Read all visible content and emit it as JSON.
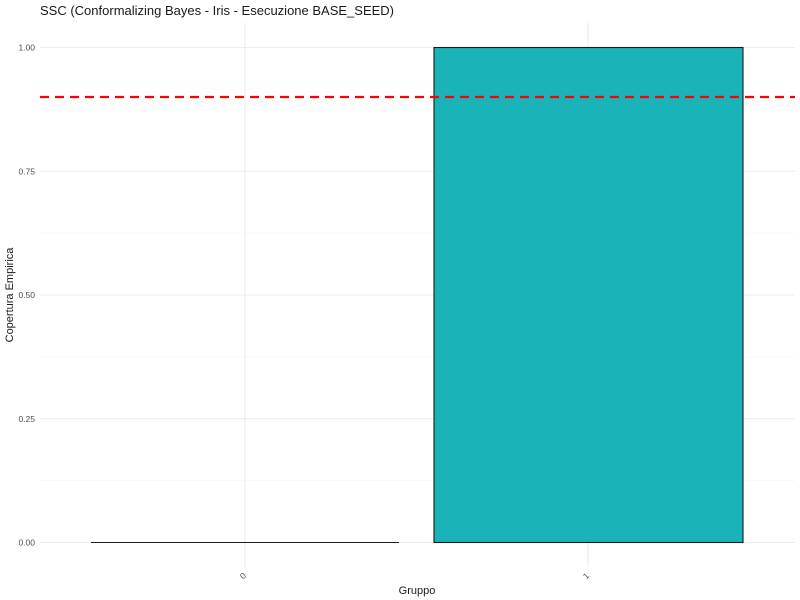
{
  "chart_data": {
    "type": "bar",
    "title": "SSC (Conformalizing Bayes - Iris - Esecuzione BASE_SEED)",
    "xlabel": "Gruppo",
    "ylabel": "Copertura Empirica",
    "categories": [
      "0",
      "1"
    ],
    "values": [
      0.0,
      1.0
    ],
    "ylim": [
      0,
      1.0
    ],
    "yticks": [
      "0.00",
      "0.25",
      "0.50",
      "0.75",
      "1.00"
    ],
    "reference_line": {
      "value": 0.9,
      "style": "dashed",
      "color": "#ff0000"
    },
    "bar_fill": "#1ab3b8",
    "bar_outline": "#1a1a1a",
    "grid": true,
    "x_tick_rotation": "45deg"
  }
}
